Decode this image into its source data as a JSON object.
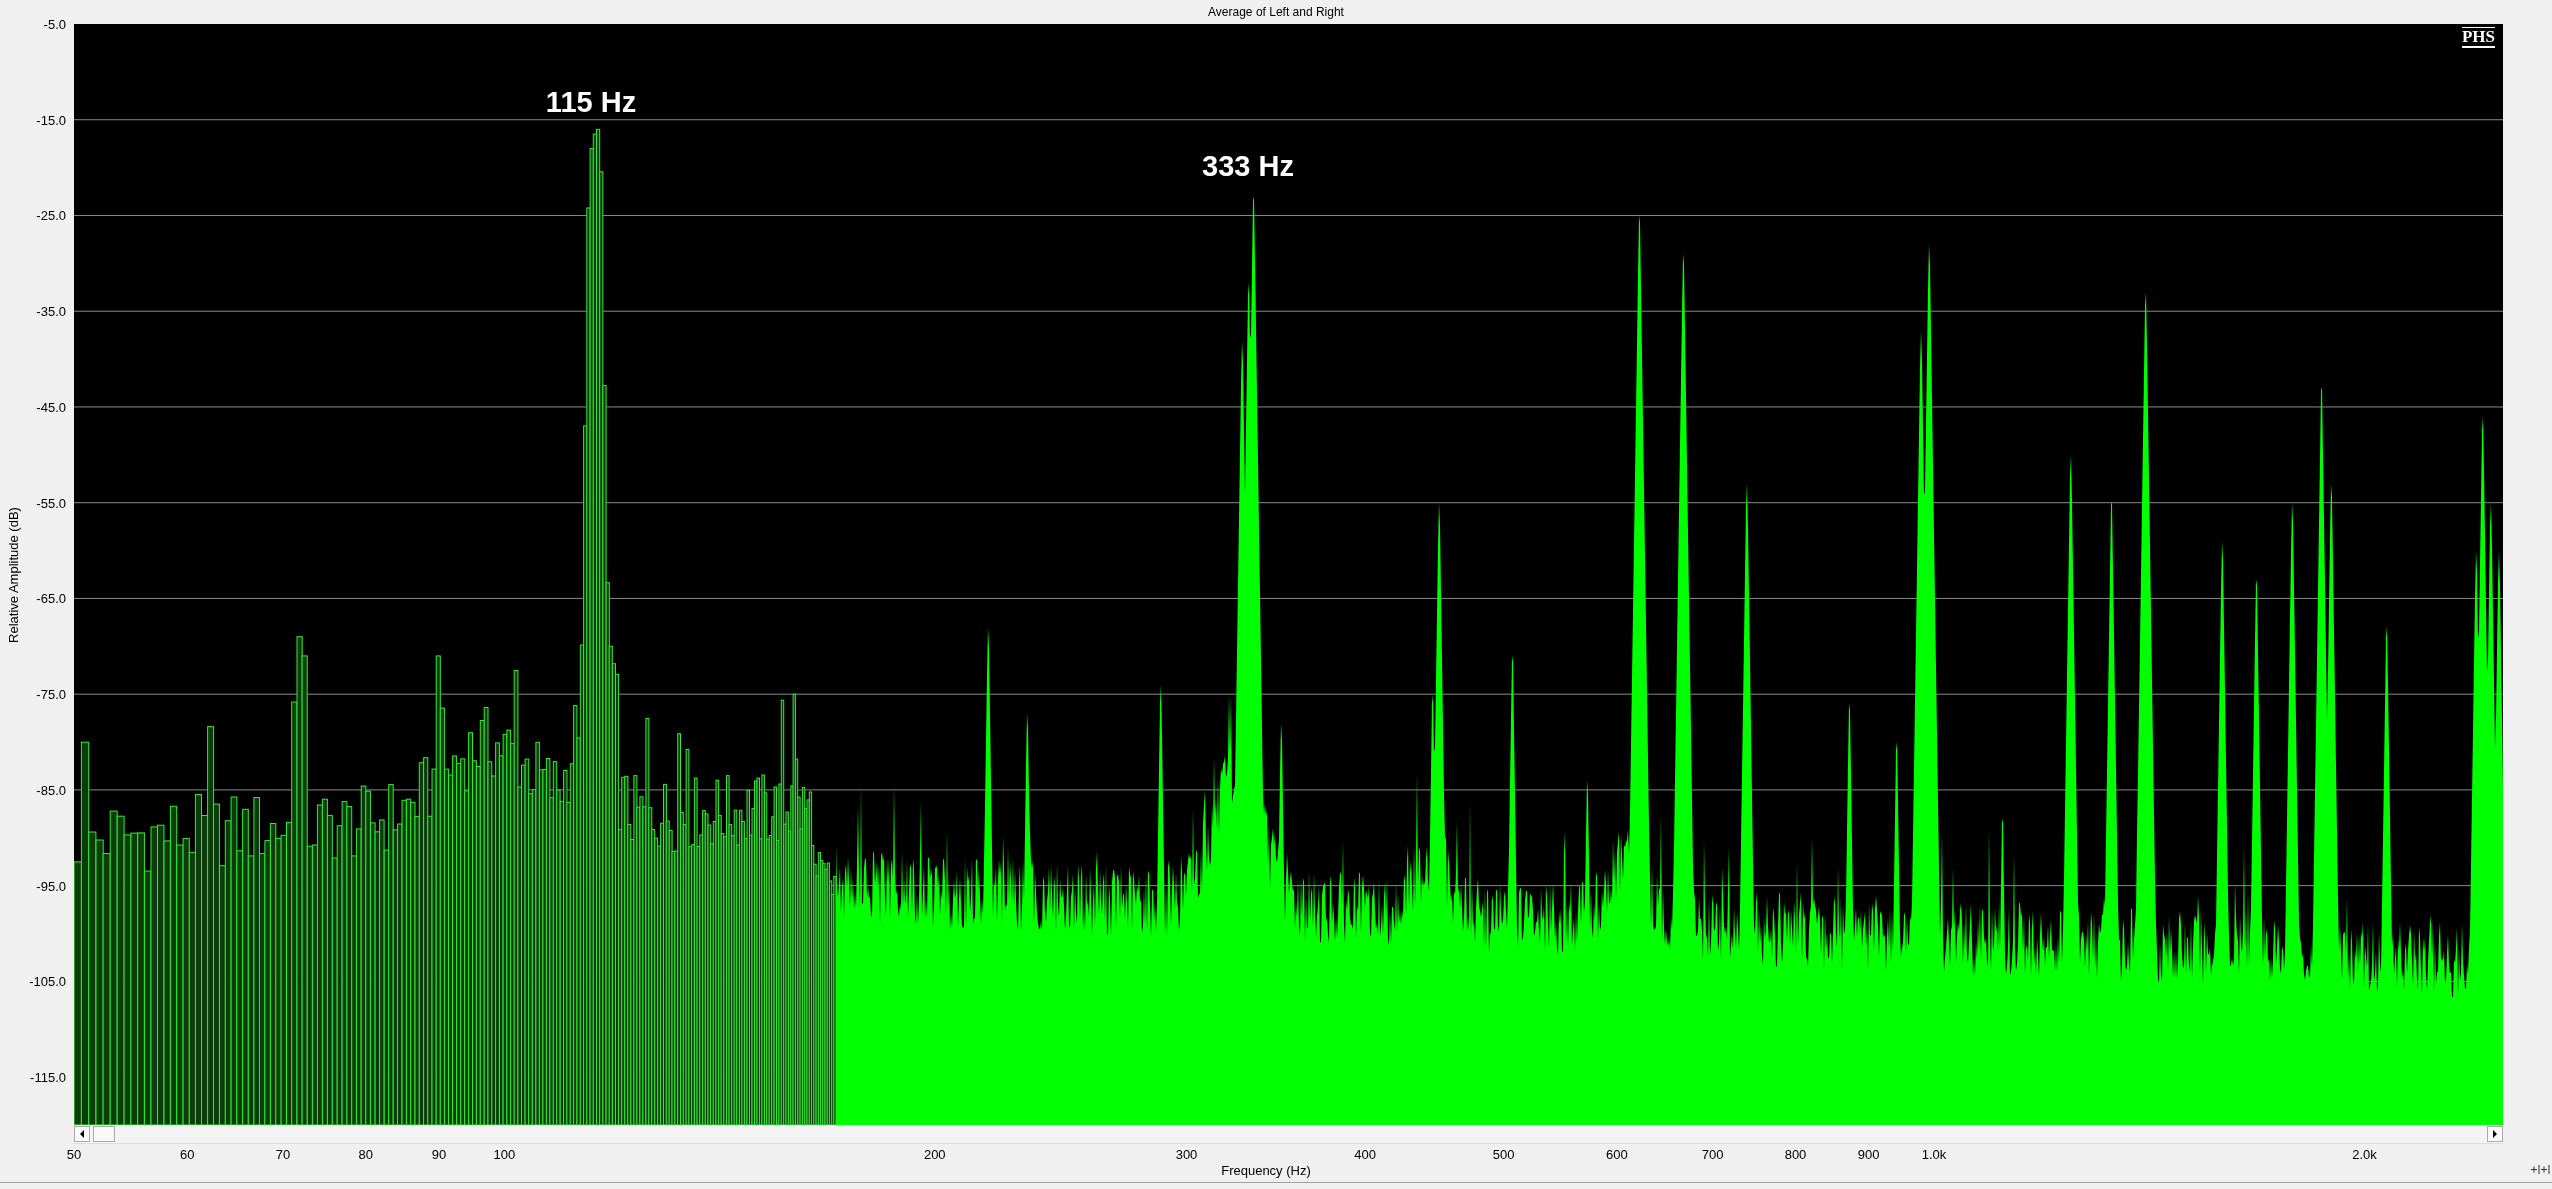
{
  "window": {
    "title": "Average of Left and Right"
  },
  "plot": {
    "logo": "PHS",
    "annotations": [
      "115 Hz",
      "333 Hz"
    ],
    "y_axis": {
      "label": "Relative Amplitude (dB)",
      "ticks": [
        "-5.0",
        "-15.0",
        "-25.0",
        "-35.0",
        "-45.0",
        "-55.0",
        "-65.0",
        "-75.0",
        "-85.0",
        "-95.0",
        "-105.0",
        "-115.0"
      ]
    },
    "x_axis": {
      "label": "Frequency (Hz)",
      "ticks": [
        "50",
        "60",
        "70",
        "80",
        "90",
        "100",
        "200",
        "300",
        "400",
        "500",
        "600",
        "700",
        "800",
        "900",
        "1.0k",
        "2.0k"
      ]
    }
  }
}
